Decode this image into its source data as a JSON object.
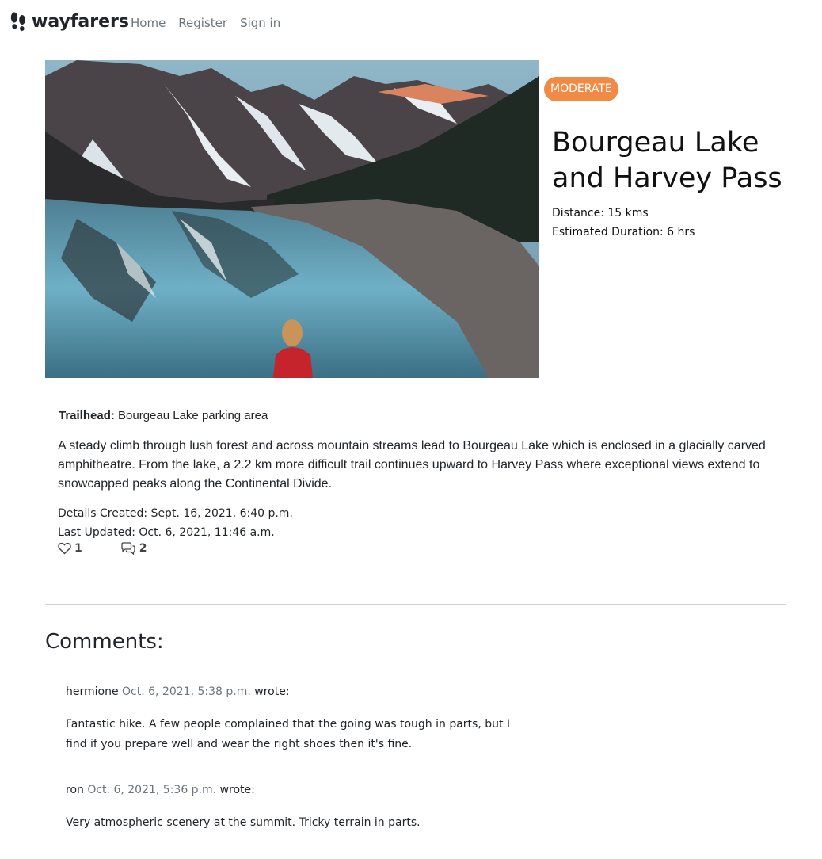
{
  "navbar": {
    "brand": "wayfarers",
    "brand_icon": "footprints-icon",
    "links": [
      "Home",
      "Register",
      "Sign in"
    ]
  },
  "hike": {
    "difficulty": "MODERATE",
    "title": "Bourgeau Lake and Harvey Pass",
    "distance": "Distance: 15 kms",
    "duration": "Estimated Duration: 6 hrs",
    "image": "mountain-lake-photo",
    "trailhead_label": "Trailhead:",
    "trailhead_value": " Bourgeau Lake parking area",
    "description": "A steady climb through lush forest and across mountain streams lead to Bourgeau Lake which is enclosed in a glacially carved amphitheatre. From the lake, a 2.2 km more difficult trail continues upward to Harvey Pass where exceptional views extend to snowcapped peaks along the Continental Divide.",
    "created": "Details Created: Sept. 16, 2021, 6:40 p.m.",
    "updated": "Last Updated: Oct. 6, 2021, 11:46 a.m.",
    "likes": "1",
    "comments_count": "2"
  },
  "comments_section": {
    "title": "Comments:",
    "items": [
      {
        "author": "hermione",
        "time": "Oct. 6, 2021, 5:38 p.m.",
        "wrote": "wrote:",
        "text": "Fantastic hike. A few people complained that the going was tough in parts, but I find if you prepare well and wear the right shoes then it's fine."
      },
      {
        "author": "ron",
        "time": "Oct. 6, 2021, 5:36 p.m.",
        "wrote": "wrote:",
        "text": "Very atmospheric scenery at the summit. Tricky terrain in parts."
      }
    ]
  },
  "colors": {
    "badge": "#f08a45",
    "muted": "#6c757d"
  }
}
